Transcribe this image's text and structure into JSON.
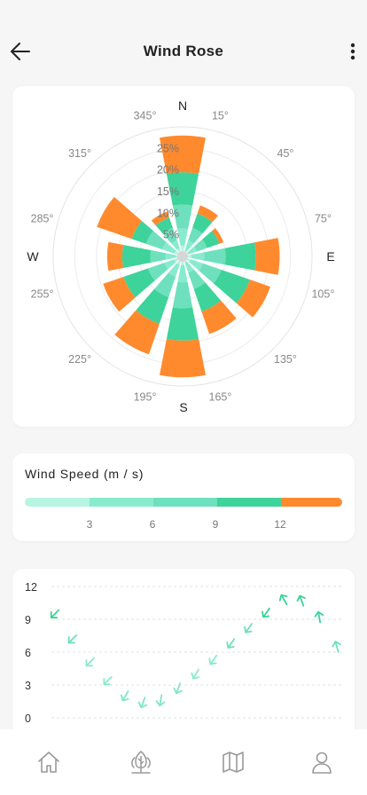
{
  "header": {
    "title": "Wind Rose",
    "back_icon": "arrow-left-icon",
    "more_icon": "more-vertical-icon"
  },
  "rose": {
    "cardinals": {
      "n": "N",
      "e": "E",
      "s": "S",
      "w": "W"
    },
    "angle_labels": [
      "15°",
      "45°",
      "75°",
      "105°",
      "135°",
      "165°",
      "195°",
      "225°",
      "255°",
      "285°",
      "315°",
      "345°"
    ],
    "ring_labels": [
      "5%",
      "10%",
      "15%",
      "20%",
      "25%"
    ],
    "colors": [
      "#b8f4e2",
      "#89ebcd",
      "#6ee0bd",
      "#3dd39a",
      "#ff8a2e"
    ]
  },
  "chart_data": [
    {
      "type": "wind-rose",
      "title": "",
      "directions_deg": [
        0,
        30,
        60,
        90,
        120,
        150,
        180,
        210,
        240,
        270,
        300,
        330
      ],
      "radial_unit": "%",
      "radial_ticks": [
        5,
        10,
        15,
        20,
        25
      ],
      "rlim": [
        0,
        30
      ],
      "series": [
        {
          "values": [
            2.5,
            1.5,
            1.5,
            2.0,
            2.0,
            1.5,
            2.0,
            2.0,
            2.0,
            1.5,
            2.0,
            2.0
          ]
        },
        {
          "values": [
            4.0,
            2.5,
            2.0,
            3.0,
            3.0,
            2.5,
            4.0,
            3.0,
            2.5,
            2.5,
            3.0,
            2.0
          ]
        },
        {
          "values": [
            5.5,
            3.0,
            2.5,
            5.0,
            4.5,
            4.0,
            6.0,
            5.0,
            4.0,
            3.5,
            4.0,
            3.0
          ]
        },
        {
          "values": [
            7.5,
            3.5,
            3.0,
            7.0,
            7.0,
            5.5,
            7.5,
            6.5,
            6.0,
            6.5,
            3.5,
            2.5
          ]
        },
        {
          "values": [
            8.5,
            2.0,
            1.0,
            5.5,
            5.0,
            5.5,
            8.5,
            7.5,
            5.0,
            3.5,
            8.5,
            1.5
          ]
        }
      ]
    },
    {
      "type": "scatter",
      "title": "",
      "yticks": [
        0,
        3,
        6,
        9,
        12
      ],
      "ylim": [
        0,
        12
      ],
      "points": [
        {
          "y": 9.5,
          "dir": 225
        },
        {
          "y": 7.2,
          "dir": 225
        },
        {
          "y": 5.1,
          "dir": 225
        },
        {
          "y": 3.4,
          "dir": 225
        },
        {
          "y": 2.0,
          "dir": 210
        },
        {
          "y": 1.4,
          "dir": 200
        },
        {
          "y": 1.6,
          "dir": 190
        },
        {
          "y": 2.7,
          "dir": 200
        },
        {
          "y": 4.0,
          "dir": 210
        },
        {
          "y": 5.3,
          "dir": 215
        },
        {
          "y": 6.8,
          "dir": 215
        },
        {
          "y": 8.2,
          "dir": 215
        },
        {
          "y": 9.6,
          "dir": 215
        },
        {
          "y": 10.8,
          "dir": 330
        },
        {
          "y": 10.7,
          "dir": 340
        },
        {
          "y": 9.2,
          "dir": 350
        },
        {
          "y": 6.5,
          "dir": 345
        }
      ]
    }
  ],
  "legend": {
    "title": "Wind Speed (m / s)",
    "ticks": [
      "3",
      "6",
      "9",
      "12"
    ],
    "colors": [
      "#b8f4e2",
      "#89ebcd",
      "#6ee0bd",
      "#3dd39a",
      "#ff8a2e"
    ]
  },
  "nav": [
    {
      "icon": "home-icon"
    },
    {
      "icon": "forest-icon"
    },
    {
      "icon": "map-icon"
    },
    {
      "icon": "profile-icon"
    }
  ]
}
